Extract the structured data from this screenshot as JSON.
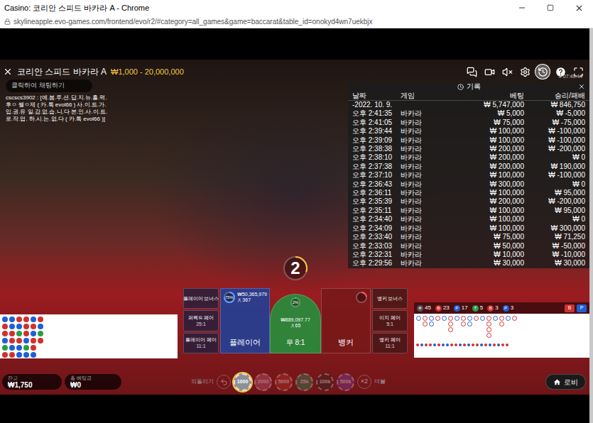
{
  "window": {
    "title": "Casino: 코리안 스피드 바카라 A - Chrome",
    "controls": [
      "minimize",
      "maximize",
      "close"
    ]
  },
  "address_bar": {
    "url": "skylineapple.evo-games.com/frontend/evo/r2/#category=all_games&game=baccarat&table_id=onokyd4wn7uekbjx"
  },
  "game": {
    "table_name": "코리안 스피드 바카라 A",
    "limits": "₩1,000 - 20,000,000",
    "clock": "# 07:49:44",
    "timer": "2",
    "timer_level": 0.3
  },
  "toolbar": [
    {
      "kind": "chat",
      "selected": false,
      "muted": false
    },
    {
      "kind": "video",
      "selected": false,
      "muted": false
    },
    {
      "kind": "sound",
      "selected": false,
      "muted": true
    },
    {
      "kind": "settings",
      "selected": false,
      "muted": false
    },
    {
      "kind": "history",
      "selected": true,
      "muted": false
    },
    {
      "kind": "help",
      "selected": false,
      "muted": false
    },
    {
      "kind": "fullscreen",
      "selected": false,
      "muted": false
    }
  ],
  "chat": {
    "placeholder": "클릭하여 채팅하기",
    "message": "cscscs3902 : [예.봄.루.션.답.지.뉴.홀.력.후ㅇ 쎌ㅇ제 ( 카.톡 evol66 ) 사.이.트.가.입.권.유 일.감.없.습.니.다 본.인.사.이.트.로.작.업. 하.시.는.없.다 ( 카.톡 evol66 )]"
  },
  "history": {
    "title": "기록",
    "columns": [
      "날짜",
      "게임",
      "베팅",
      "승리/패배"
    ],
    "summary": {
      "date": "-2022. 10. 9.",
      "bet": "₩ 5,747,000",
      "result": "₩ 846,750"
    },
    "rows": [
      {
        "time": "오후 2:41:35",
        "game": "바카라",
        "bet": "₩ 5,000",
        "result": "₩ -5,000"
      },
      {
        "time": "오후 2:41:05",
        "game": "바카라",
        "bet": "₩ 75,000",
        "result": "₩ -75,000"
      },
      {
        "time": "오후 2:39:44",
        "game": "바카라",
        "bet": "₩ 100,000",
        "result": "₩ -100,000"
      },
      {
        "time": "오후 2:39:09",
        "game": "바카라",
        "bet": "₩ 100,000",
        "result": "₩ -100,000"
      },
      {
        "time": "오후 2:38:38",
        "game": "바카라",
        "bet": "₩ 200,000",
        "result": "₩ -200,000"
      },
      {
        "time": "오후 2:38:10",
        "game": "바카라",
        "bet": "₩ 200,000",
        "result": "₩ 0"
      },
      {
        "time": "오후 2:37:38",
        "game": "바카라",
        "bet": "₩ 200,000",
        "result": "₩ 190,000"
      },
      {
        "time": "오후 2:37:10",
        "game": "바카라",
        "bet": "₩ 100,000",
        "result": "₩ -100,000"
      },
      {
        "time": "오후 2:36:43",
        "game": "바카라",
        "bet": "₩ 300,000",
        "result": "₩ 0"
      },
      {
        "time": "오후 2:36:11",
        "game": "바카라",
        "bet": "₩ 100,000",
        "result": "₩ 95,000"
      },
      {
        "time": "오후 2:35:39",
        "game": "바카라",
        "bet": "₩ 200,000",
        "result": "₩ -200,000"
      },
      {
        "time": "오후 2:35:11",
        "game": "바카라",
        "bet": "₩ 100,000",
        "result": "₩ 95,000"
      },
      {
        "time": "오후 2:34:40",
        "game": "바카라",
        "bet": "₩ 100,000",
        "result": "₩ 0"
      },
      {
        "time": "오후 2:34:09",
        "game": "바카라",
        "bet": "₩ 100,000",
        "result": "₩ 300,000"
      },
      {
        "time": "오후 2:33:40",
        "game": "바카라",
        "bet": "₩ 75,000",
        "result": "₩ 71,250"
      },
      {
        "time": "오후 2:33:03",
        "game": "바카라",
        "bet": "₩ 50,000",
        "result": "₩ -50,000"
      },
      {
        "time": "오후 2:32:31",
        "game": "바카라",
        "bet": "₩ 10,000",
        "result": "₩ -10,000"
      },
      {
        "time": "오후 2:29:56",
        "game": "바카라",
        "bet": "₩ 30,000",
        "result": "₩ 30,000"
      }
    ]
  },
  "bets": {
    "left_side": [
      {
        "label": "플레이어 보너스",
        "payout": ""
      },
      {
        "label": "퍼펙트 페어",
        "payout": "25:1"
      },
      {
        "label": "플레이어 페어",
        "payout": "11:1"
      }
    ],
    "player": {
      "label": "플레이어",
      "percent": "75%",
      "level": 0.75,
      "amount": "₩50,365,979",
      "players": "367"
    },
    "tie": {
      "label": "무 8:1",
      "percent": "2%",
      "level": 0.02,
      "amount": "₩889,097.77",
      "players": "65"
    },
    "banker": {
      "label": "뱅커",
      "level": 0.23
    },
    "right_side": [
      {
        "label": "뱅커 보너스",
        "payout": ""
      },
      {
        "label": "이지 페어",
        "payout": "5:1"
      },
      {
        "label": "뱅커 페어",
        "payout": "11:1"
      }
    ]
  },
  "bead_plate": [
    {
      "color": "#1f5fd6"
    },
    {
      "color": "#d0312d"
    },
    {
      "color": "#d0312d"
    },
    {
      "color": "#1f5fd6"
    },
    {
      "color": "#2a9d46"
    },
    {
      "color": "#d0312d"
    },
    {
      "color": "#1f5fd6"
    },
    {
      "color": "#1f5fd6"
    },
    {
      "color": "#d0312d"
    },
    {
      "color": "#d0312d"
    },
    {
      "color": "#1f5fd6"
    },
    {
      "color": "#d0312d"
    },
    {
      "color": "#d0312d"
    },
    {
      "color": "#1f5fd6"
    },
    {
      "color": "#2a9d46"
    },
    {
      "color": "#d0312d"
    },
    {
      "color": "#1f5fd6"
    },
    {
      "color": "#1f5fd6"
    },
    {
      "color": "#d0312d"
    },
    {
      "color": "#d0312d"
    },
    {
      "color": "#d0312d"
    },
    {
      "color": "#1f5fd6"
    },
    {
      "color": "#2a9d46"
    },
    {
      "color": "#1f5fd6"
    },
    {
      "color": "#1f5fd6"
    },
    {
      "color": "#d0312d"
    },
    {
      "color": "#1f5fd6"
    },
    {
      "color": "#d0312d"
    },
    {
      "color": "#d0312d"
    },
    {
      "color": "#1f5fd6"
    },
    {
      "color": "#d0312d"
    },
    {
      "color": "#1f5fd6"
    },
    {
      "color": "#2a9d46"
    },
    {
      "color": "#d0312d"
    }
  ],
  "stats": [
    {
      "label": "#",
      "value": "45",
      "color": "#555555"
    },
    {
      "label": "B",
      "value": "23",
      "color": "#d0312d"
    },
    {
      "label": "P",
      "value": "17",
      "color": "#1f5fd6"
    },
    {
      "label": "T",
      "value": "5",
      "color": "#2a9d46"
    },
    {
      "label": "B",
      "value": "3",
      "color": "#d0312d"
    },
    {
      "label": "P",
      "value": "3",
      "color": "#1f5fd6"
    }
  ],
  "predictions": [
    {
      "label": "B",
      "color": "#d0312d"
    },
    {
      "label": "P",
      "color": "#1f5fd6"
    }
  ],
  "big_road": [
    {
      "color": "#1f5fd6",
      "length": 1
    },
    {
      "color": "#d0312d",
      "length": 2
    },
    {
      "color": "#1f5fd6",
      "length": 2
    },
    {
      "color": "#d0312d",
      "length": 1
    },
    {
      "color": "#1f5fd6",
      "length": 1
    },
    {
      "color": "#d0312d",
      "length": 3
    },
    {
      "color": "#1f5fd6",
      "length": 1
    },
    {
      "color": "#d0312d",
      "length": 2
    },
    {
      "color": "#1f5fd6",
      "length": 2
    },
    {
      "color": "#d0312d",
      "length": 1
    },
    {
      "color": "#1f5fd6",
      "length": 1
    },
    {
      "color": "#d0312d",
      "length": 4
    },
    {
      "color": "#1f5fd6",
      "length": 1
    },
    {
      "color": "#d0312d",
      "length": 2
    },
    {
      "color": "#1f5fd6",
      "length": 1
    },
    {
      "color": "#d0312d",
      "length": 1
    }
  ],
  "derived_road": [
    {
      "color": "#d0312d"
    },
    {
      "color": "#1f5fd6"
    },
    {
      "color": "#d0312d"
    },
    {
      "color": "#d0312d"
    },
    {
      "color": "#1f5fd6"
    },
    {
      "color": "#d0312d"
    },
    {
      "color": "#1f5fd6"
    },
    {
      "color": "#1f5fd6"
    },
    {
      "color": "#d0312d"
    },
    {
      "color": "#d0312d"
    },
    {
      "color": "#1f5fd6"
    },
    {
      "color": "#d0312d"
    },
    {
      "color": "#1f5fd6"
    },
    {
      "color": "#d0312d"
    },
    {
      "color": "#d0312d"
    },
    {
      "color": "#1f5fd6"
    },
    {
      "color": "#d0312d"
    },
    {
      "color": "#1f5fd6"
    },
    {
      "color": "#d0312d"
    },
    {
      "color": "#1f5fd6"
    },
    {
      "color": "#d0312d"
    },
    {
      "color": "#d0312d"
    }
  ],
  "footer": {
    "balance": {
      "label": "잔고",
      "value": "₩1,750"
    },
    "total_bet": {
      "label": "총 베팅금",
      "value": "₩0"
    },
    "undo": {
      "label": "되돌리기",
      "disabled": true
    },
    "chips": [
      {
        "value": "1000",
        "selected": true,
        "disabled": false,
        "color": "#8d9096"
      },
      {
        "value": "2000",
        "selected": false,
        "disabled": true,
        "color": "#c4577f"
      },
      {
        "value": "5000",
        "selected": false,
        "disabled": true,
        "color": "#b8322c"
      },
      {
        "value": "25k",
        "selected": false,
        "disabled": true,
        "color": "#2e8b57"
      },
      {
        "value": "100k",
        "selected": false,
        "disabled": true,
        "color": "#2a2a2a"
      },
      {
        "value": "500k",
        "selected": false,
        "disabled": true,
        "color": "#7b3fa0"
      }
    ],
    "double": {
      "icon_text": "×2",
      "label": "더블",
      "disabled": true
    },
    "lobby": "로비"
  }
}
